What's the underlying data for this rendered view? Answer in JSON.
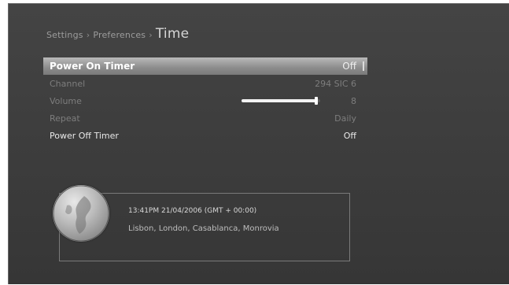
{
  "breadcrumb": {
    "items": [
      "Settings",
      "Preferences"
    ],
    "separator": "›",
    "current": "Time"
  },
  "menu": {
    "rows": [
      {
        "label": "Power On Timer",
        "value": "Off",
        "state": "selected"
      },
      {
        "label": "Channel",
        "value": "294 SIC 6",
        "state": "disabled"
      },
      {
        "label": "Volume",
        "value": "8",
        "state": "disabled"
      },
      {
        "label": "Repeat",
        "value": "Daily",
        "state": "disabled"
      },
      {
        "label": "Power Off Timer",
        "value": "Off",
        "state": "enabled"
      }
    ],
    "volume_level": 0.95
  },
  "info": {
    "time_line": "13:41PM 21/04/2006 (GMT + 00:00)",
    "zone_line": "Lisbon, London, Casablanca, Monrovia"
  },
  "colors": {
    "background": "#3e3e3e",
    "selected_row": "#9a9a9a",
    "text_enabled": "#e8e8e8",
    "text_disabled": "#7d7d7d"
  },
  "icons": {
    "globe": "globe-icon"
  }
}
